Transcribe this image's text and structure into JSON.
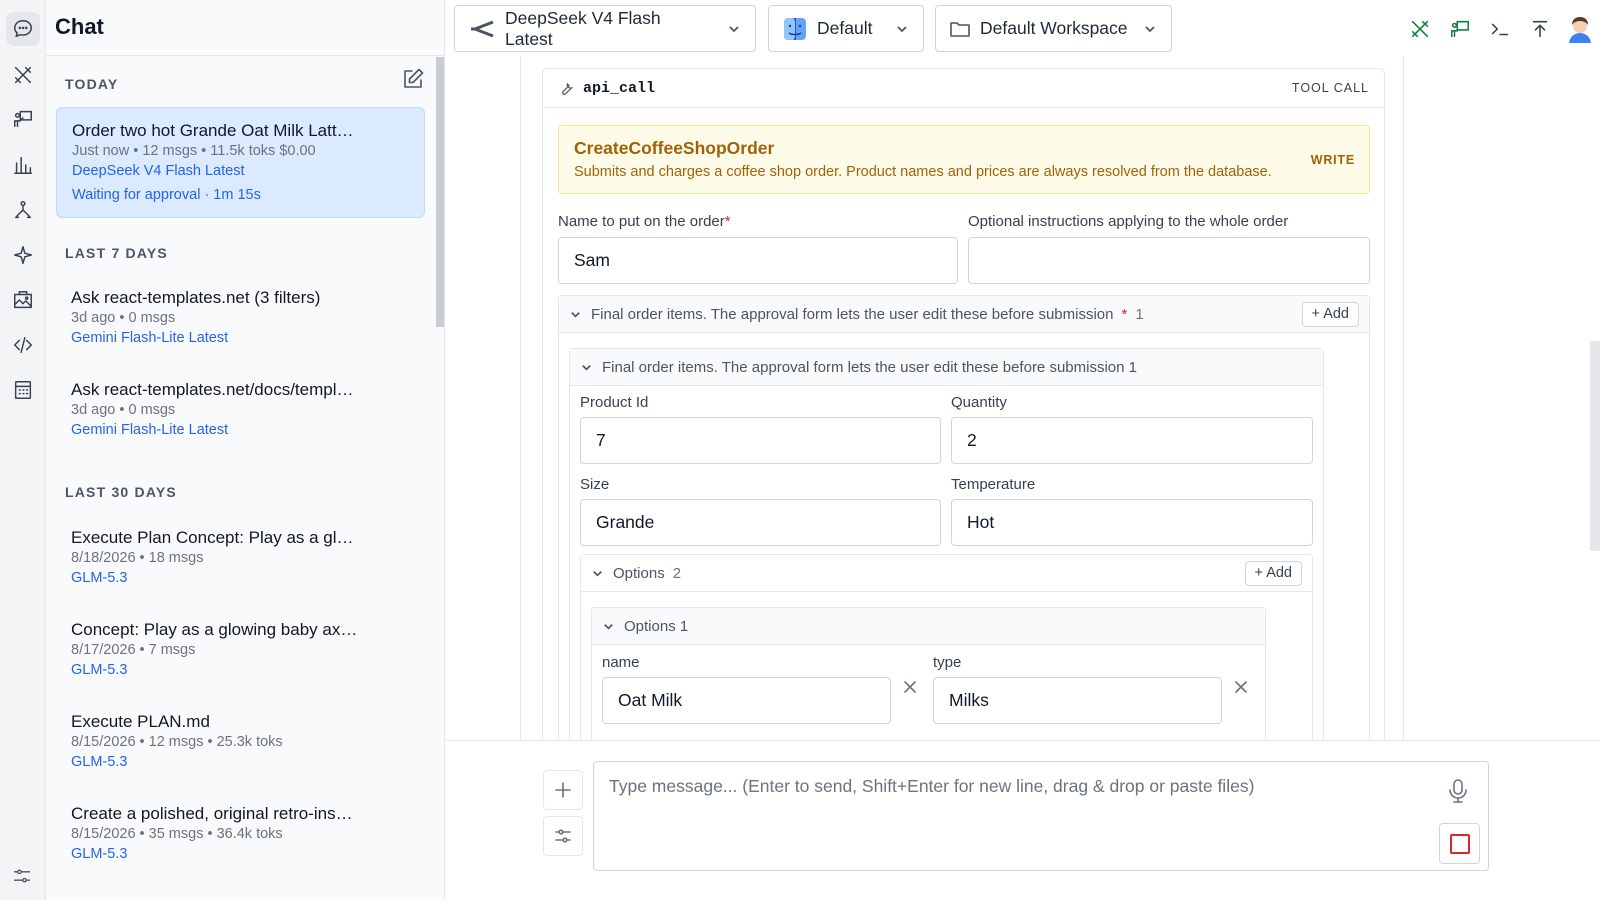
{
  "sidebar": {
    "title": "Chat",
    "groups": {
      "today": "TODAY",
      "last7": "LAST 7 DAYS",
      "last30": "LAST 30 DAYS"
    },
    "conversations": [
      {
        "title": "Order two hot Grande Oat Milk Latt…",
        "meta": "Just now • 12 msgs • 11.5k toks $0.00",
        "model": "DeepSeek V4 Flash Latest",
        "status": "Waiting for approval · 1m 15s"
      },
      {
        "title": "Ask react-templates.net (3 filters)",
        "meta": "3d ago • 0 msgs",
        "model": "Gemini Flash-Lite Latest"
      },
      {
        "title": "Ask react-templates.net/docs/templ…",
        "meta": "3d ago • 0 msgs",
        "model": "Gemini Flash-Lite Latest"
      },
      {
        "title": "Execute Plan Concept: Play as a gl…",
        "meta": "8/18/2026 • 18 msgs",
        "model": "GLM-5.3"
      },
      {
        "title": "Concept: Play as a glowing baby ax…",
        "meta": "8/17/2026 • 7 msgs",
        "model": "GLM-5.3"
      },
      {
        "title": "Execute PLAN.md",
        "meta": "8/15/2026 • 12 msgs • 25.3k toks",
        "model": "GLM-5.3"
      },
      {
        "title": "Create a polished, original retro-ins…",
        "meta": "8/15/2026 • 35 msgs • 36.4k toks",
        "model": "GLM-5.3"
      }
    ]
  },
  "topbar": {
    "model": "DeepSeek V4 Flash Latest",
    "preset": "Default",
    "workspace": "Default Workspace"
  },
  "tool_call": {
    "name": "api_call",
    "tag": "TOOL CALL",
    "operation": "CreateCoffeeShopOrder",
    "description": "Submits and charges a coffee shop order. Product names and prices are always resolved from the database.",
    "access": "WRITE",
    "fields": {
      "name_label": "Name to put on the order",
      "required_mark": "*",
      "name_value": "Sam",
      "instructions_label": "Optional instructions applying to the whole order",
      "instructions_value": ""
    },
    "items_section": {
      "title": "Final order items. The approval form lets the user edit these before submission",
      "required_mark": "*",
      "count": "1",
      "add_label": "+ Add",
      "item_title": "Final order items. The approval form lets the user edit these before submission 1",
      "product_id_label": "Product Id",
      "product_id_value": "7",
      "quantity_label": "Quantity",
      "quantity_value": "2",
      "size_label": "Size",
      "size_value": "Grande",
      "temperature_label": "Temperature",
      "temperature_value": "Hot",
      "options": {
        "title": "Options",
        "count": "2",
        "add_label": "+ Add",
        "item_title": "Options 1",
        "name_label": "name",
        "name_value": "Oat Milk",
        "type_label": "type",
        "type_value": "Milks"
      }
    }
  },
  "composer": {
    "placeholder": "Type message... (Enter to send, Shift+Enter for new line, drag & drop or paste files)"
  },
  "colors": {
    "accent": "#2563eb",
    "active_bg": "#dbeafe",
    "warning_bg": "#fefce8",
    "warning_text": "#a16207",
    "stop": "#dc2626",
    "tool_green": "#15803d"
  },
  "icons": {
    "rail": [
      "chat-icon",
      "tools-icon",
      "presenter-icon",
      "analytics-icon",
      "pipeline-icon",
      "sparkle-icon",
      "gallery-icon",
      "code-icon",
      "calculator-icon"
    ],
    "top": [
      "tools-icon",
      "presenter-icon",
      "terminal-icon",
      "upload-icon",
      "avatar"
    ]
  }
}
